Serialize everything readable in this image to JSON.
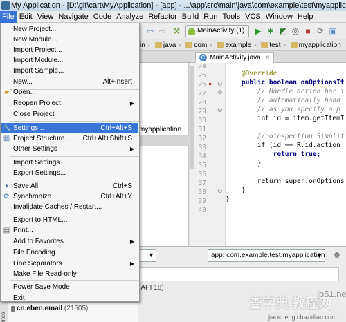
{
  "window": {
    "title": "My Application - [D:\\git\\cart\\MyApplication] - [app] - ...\\app\\src\\main\\java\\com\\example\\test\\myapplication"
  },
  "menubar": [
    "File",
    "Edit",
    "View",
    "Navigate",
    "Code",
    "Analyze",
    "Refactor",
    "Build",
    "Run",
    "Tools",
    "VCS",
    "Window",
    "Help"
  ],
  "toolbar": {
    "run_config": "MainActivity (1)",
    "run_config_arrow": "▾"
  },
  "breadcrumb": [
    "in",
    "java",
    "com",
    "example",
    "test",
    "myapplication"
  ],
  "editor_tab": {
    "label": "MainActivity.java",
    "close": "×",
    "icon_letter": "C"
  },
  "project_pane": {
    "visible_item": "myapplication"
  },
  "file_menu": [
    {
      "label": "New Project...",
      "shortcut": ""
    },
    {
      "label": "New Module...",
      "shortcut": ""
    },
    {
      "label": "Import Project...",
      "shortcut": ""
    },
    {
      "label": "Import Module...",
      "shortcut": ""
    },
    {
      "label": "Import Sample...",
      "shortcut": ""
    },
    {
      "label": "New...",
      "shortcut": "Alt+Insert"
    },
    {
      "label": "Open...",
      "shortcut": ""
    },
    {
      "label": "Reopen Project",
      "shortcut": "",
      "submenu": true
    },
    {
      "label": "Close Project",
      "shortcut": ""
    },
    {
      "label": "Settings...",
      "shortcut": "Ctrl+Alt+S",
      "highlighted": true
    },
    {
      "label": "Project Structure...",
      "shortcut": "Ctrl+Alt+Shift+S"
    },
    {
      "label": "Other Settings",
      "shortcut": "",
      "submenu": true
    },
    {
      "label": "Import Settings...",
      "shortcut": ""
    },
    {
      "label": "Export Settings...",
      "shortcut": ""
    },
    {
      "label": "Save All",
      "shortcut": "Ctrl+S"
    },
    {
      "label": "Synchronize",
      "shortcut": "Ctrl+Alt+Y"
    },
    {
      "label": "Invalidate Caches / Restart...",
      "shortcut": ""
    },
    {
      "label": "Export to HTML...",
      "shortcut": ""
    },
    {
      "label": "Print...",
      "shortcut": ""
    },
    {
      "label": "Add to Favorites",
      "shortcut": "",
      "submenu": true
    },
    {
      "label": "File Encoding",
      "shortcut": ""
    },
    {
      "label": "Line Separators",
      "shortcut": "",
      "submenu": true
    },
    {
      "label": "Make File Read-only",
      "shortcut": ""
    },
    {
      "label": "Power Save Mode",
      "shortcut": ""
    },
    {
      "label": "Exit",
      "shortcut": ""
    }
  ],
  "editor": {
    "line_numbers": [
      "24",
      "25",
      "26",
      "27",
      "28",
      "29",
      "30",
      "31",
      "32",
      "33",
      "34",
      "35",
      "36",
      "37",
      "38",
      "39",
      "40"
    ],
    "lines": [
      "",
      "    @Override",
      "    public boolean onOptionsIt",
      "        // Handle action bar i",
      "        // automatically hand",
      "        // as you specify a p",
      "        int id = item.getItemI",
      "",
      "        //noinspection Simplif",
      "        if (id == R.id.action_",
      "            return true;",
      "        }",
      "",
      "        return super.onOptions",
      "    }",
      "}",
      ""
    ]
  },
  "bottom_panel": {
    "app_select": "app: com.example.test.myapplication",
    "api_text": "(API 18)"
  },
  "process_list": {
    "package": "cn.eben.email",
    "pid": "(21505)"
  },
  "left_tool_tab": "rites",
  "watermark": {
    "main": "查字典 教程网",
    "site": "jb51.net",
    "url": "jiaocheng.chazidian.com"
  },
  "colors": {
    "menu_highlight": "#3875d7",
    "keyword": "#000080",
    "comment": "#808080",
    "annotation": "#808000"
  }
}
